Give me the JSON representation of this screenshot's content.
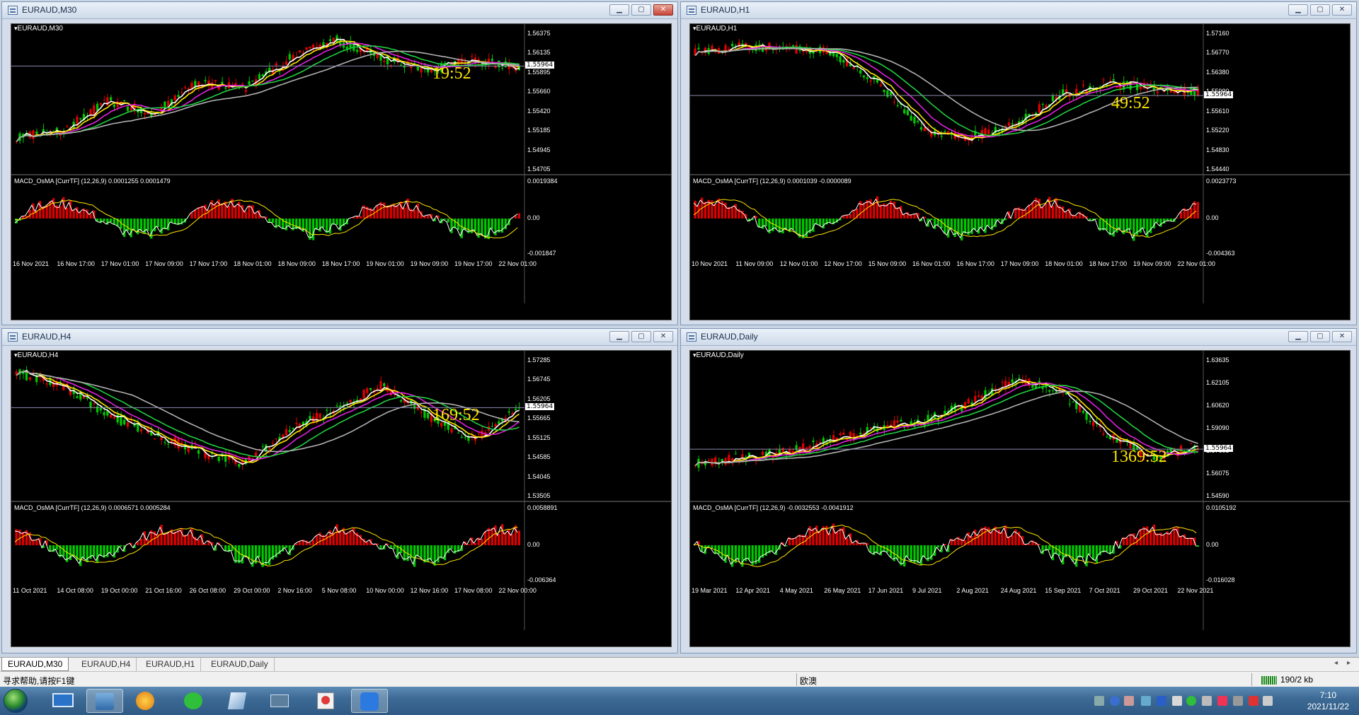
{
  "windows": [
    {
      "title": "EURAUD,M30",
      "symbol": "EURAUD,M30",
      "countdown": "19:52",
      "price_labels": [
        "1.56375",
        "1.56135",
        "1.55895",
        "1.55660",
        "1.55420",
        "1.55185",
        "1.54945",
        "1.54705"
      ],
      "current_price": "1.55964",
      "macd_title": "MACD_OsMA [CurrTF] (12,26,9) 0.0001255 0.0001479",
      "macd_labels": [
        "0.0019384",
        "0.00",
        "-0.001847"
      ],
      "time_labels": [
        "16 Nov 2021",
        "16 Nov 17:00",
        "17 Nov 01:00",
        "17 Nov 09:00",
        "17 Nov 17:00",
        "18 Nov 01:00",
        "18 Nov 09:00",
        "18 Nov 17:00",
        "19 Nov 01:00",
        "19 Nov 09:00",
        "19 Nov 17:00",
        "22 Nov 01:00"
      ]
    },
    {
      "title": "EURAUD,H1",
      "symbol": "EURAUD,H1",
      "countdown": "49:52",
      "price_labels": [
        "1.57160",
        "1.56770",
        "1.56380",
        "1.55990",
        "1.55610",
        "1.55220",
        "1.54830",
        "1.54440"
      ],
      "current_price": "1.55964",
      "macd_title": "MACD_OsMA [CurrTF] (12,26,9) 0.0001039 -0.0000089",
      "macd_labels": [
        "0.0023773",
        "0.00",
        "-0.004363"
      ],
      "time_labels": [
        "10 Nov 2021",
        "11 Nov 09:00",
        "12 Nov 01:00",
        "12 Nov 17:00",
        "15 Nov 09:00",
        "16 Nov 01:00",
        "16 Nov 17:00",
        "17 Nov 09:00",
        "18 Nov 01:00",
        "18 Nov 17:00",
        "19 Nov 09:00",
        "22 Nov 01:00"
      ]
    },
    {
      "title": "EURAUD,H4",
      "symbol": "EURAUD,H4",
      "countdown": "169:52",
      "price_labels": [
        "1.57285",
        "1.56745",
        "1.56205",
        "1.55665",
        "1.55125",
        "1.54585",
        "1.54045",
        "1.53505"
      ],
      "current_price": "1.55964",
      "macd_title": "MACD_OsMA [CurrTF] (12,26,9) 0.0006571 0.0005284",
      "macd_labels": [
        "0.0058891",
        "0.00",
        "-0.006364"
      ],
      "time_labels": [
        "11 Oct 2021",
        "14 Oct 08:00",
        "19 Oct 00:00",
        "21 Oct 16:00",
        "26 Oct 08:00",
        "29 Oct 00:00",
        "2 Nov 16:00",
        "5 Nov 08:00",
        "10 Nov 00:00",
        "12 Nov 16:00",
        "17 Nov 08:00",
        "22 Nov 00:00"
      ]
    },
    {
      "title": "EURAUD,Daily",
      "symbol": "EURAUD,Daily",
      "countdown": "1369:52",
      "price_labels": [
        "1.63635",
        "1.62105",
        "1.60620",
        "1.59090",
        "1.57605",
        "1.56075",
        "1.54590"
      ],
      "current_price": "1.55964",
      "macd_title": "MACD_OsMA [CurrTF] (12,26,9) -0.0032553 -0.0041912",
      "macd_labels": [
        "0.0105192",
        "0.00",
        "-0.016028"
      ],
      "time_labels": [
        "19 Mar 2021",
        "12 Apr 2021",
        "4 May 2021",
        "26 May 2021",
        "17 Jun 2021",
        "9 Jul 2021",
        "2 Aug 2021",
        "24 Aug 2021",
        "15 Sep 2021",
        "7 Oct 2021",
        "29 Oct 2021",
        "22 Nov 2021"
      ]
    }
  ],
  "tabs": [
    "EURAUD,M30",
    "EURAUD,H4",
    "EURAUD,H1",
    "EURAUD,Daily"
  ],
  "status": {
    "help": "寻求帮助,请按F1键",
    "profile": "欧澳",
    "traffic": "190/2 kb"
  },
  "clock": {
    "time": "7:10",
    "date": "2021/11/22"
  },
  "colors": {
    "bull": "#00c800",
    "bear": "#e00000",
    "ma_fast": "#ffffff",
    "ma_yellow": "#ffe600",
    "ma_magenta": "#e020e0",
    "ma_green": "#20d040",
    "ma_gray": "#b0b0b0"
  }
}
